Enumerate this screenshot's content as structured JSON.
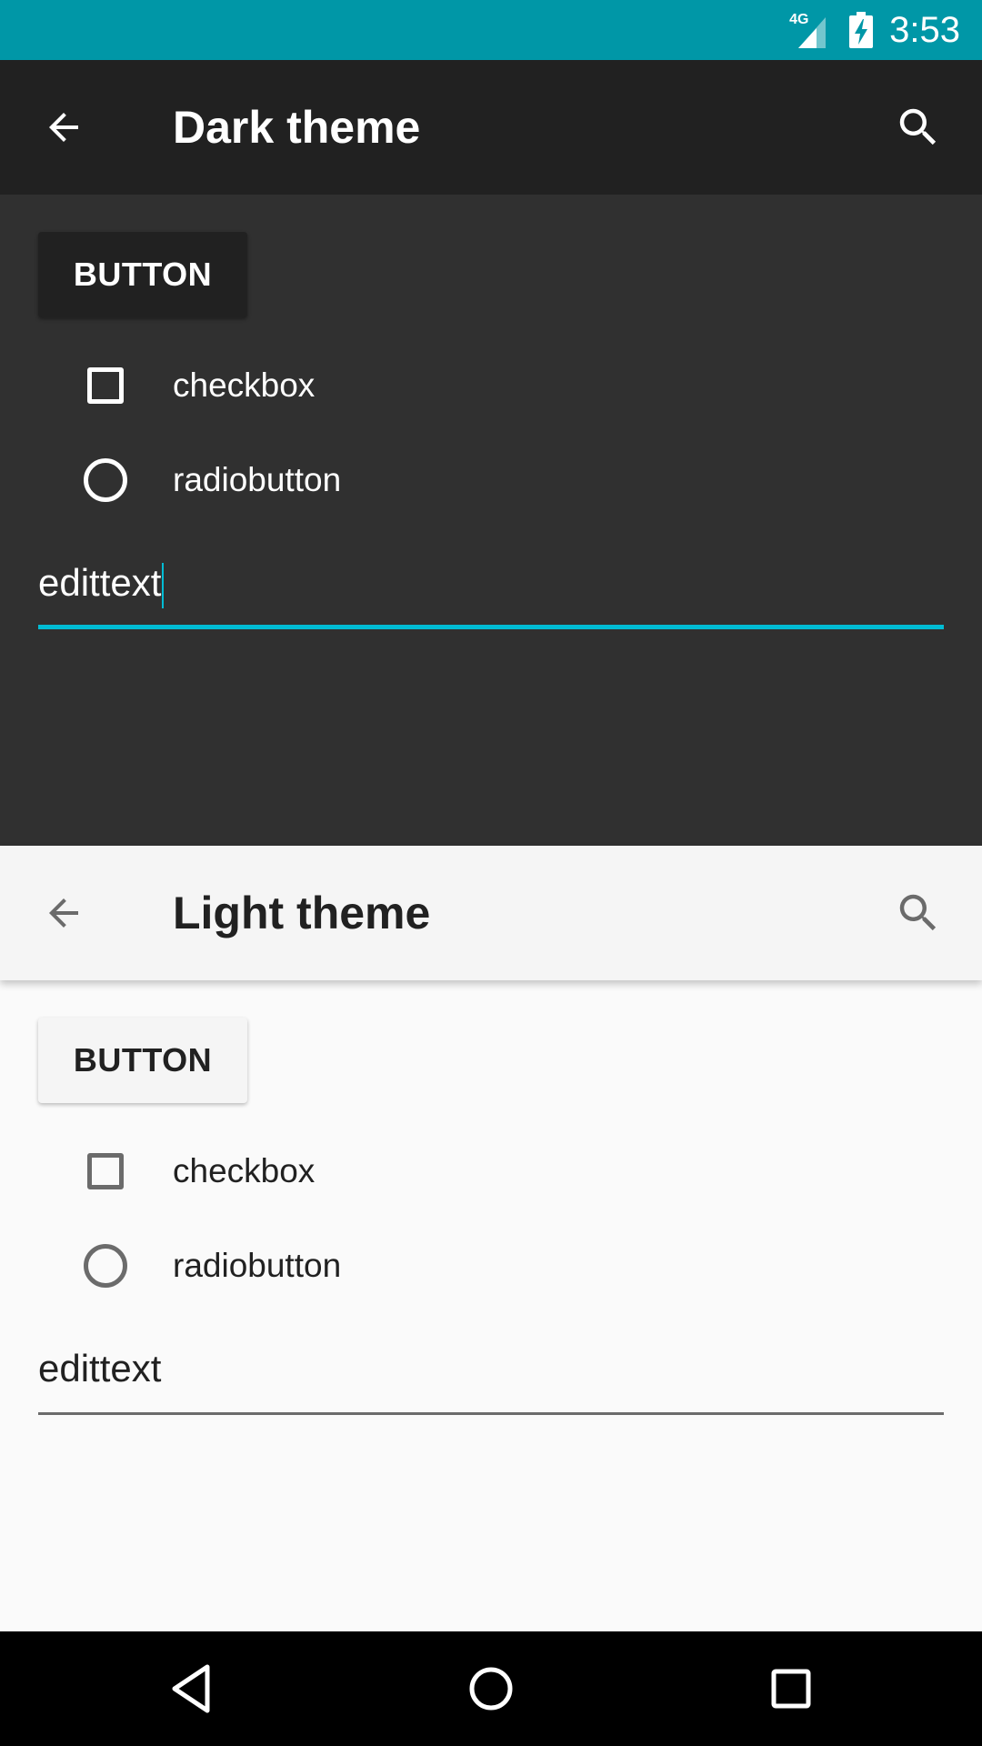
{
  "status_bar": {
    "network_type": "4G",
    "time": "3:53",
    "background_color": "#0097a7",
    "icons": [
      "signal-icon",
      "battery-charging-icon"
    ]
  },
  "dark_theme": {
    "title": "Dark theme",
    "button_label": "BUTTON",
    "checkbox_label": "checkbox",
    "checkbox_checked": false,
    "radio_label": "radiobutton",
    "radio_selected": false,
    "edittext_value": "edittext",
    "edittext_focused": true,
    "accent_color": "#00bcd4",
    "toolbar_color": "#212121",
    "background_color": "#303030",
    "icons": [
      "arrow-back-icon",
      "search-icon"
    ]
  },
  "light_theme": {
    "title": "Light theme",
    "button_label": "BUTTON",
    "checkbox_label": "checkbox",
    "checkbox_checked": false,
    "radio_label": "radiobutton",
    "radio_selected": false,
    "edittext_value": "edittext",
    "edittext_focused": false,
    "toolbar_color": "#f5f5f5",
    "background_color": "#fafafa",
    "icons": [
      "arrow-back-icon",
      "search-icon"
    ]
  },
  "nav_bar": {
    "background_color": "#000000",
    "icons": [
      "nav-back-icon",
      "nav-home-icon",
      "nav-recents-icon"
    ]
  }
}
